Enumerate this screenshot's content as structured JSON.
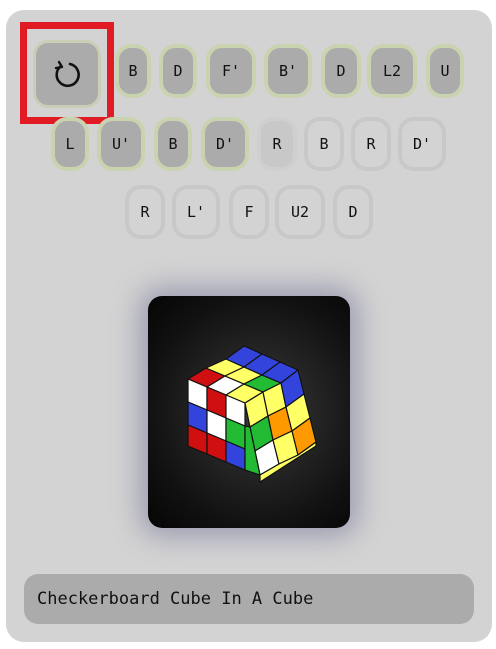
{
  "title": "Checkerboard Cube In A Cube",
  "reset": {
    "icon": "reset-icon"
  },
  "moves": [
    "B",
    "D",
    "F'",
    "B'",
    "D",
    "L2",
    "U",
    "L",
    "U'",
    "B",
    "D'",
    "R",
    "B",
    "R",
    "D'",
    "R",
    "L'",
    "F",
    "U2",
    "D"
  ],
  "colors": {
    "highlight": "#e01b24",
    "panel": "#d3d3d3",
    "done": "#ababab"
  }
}
